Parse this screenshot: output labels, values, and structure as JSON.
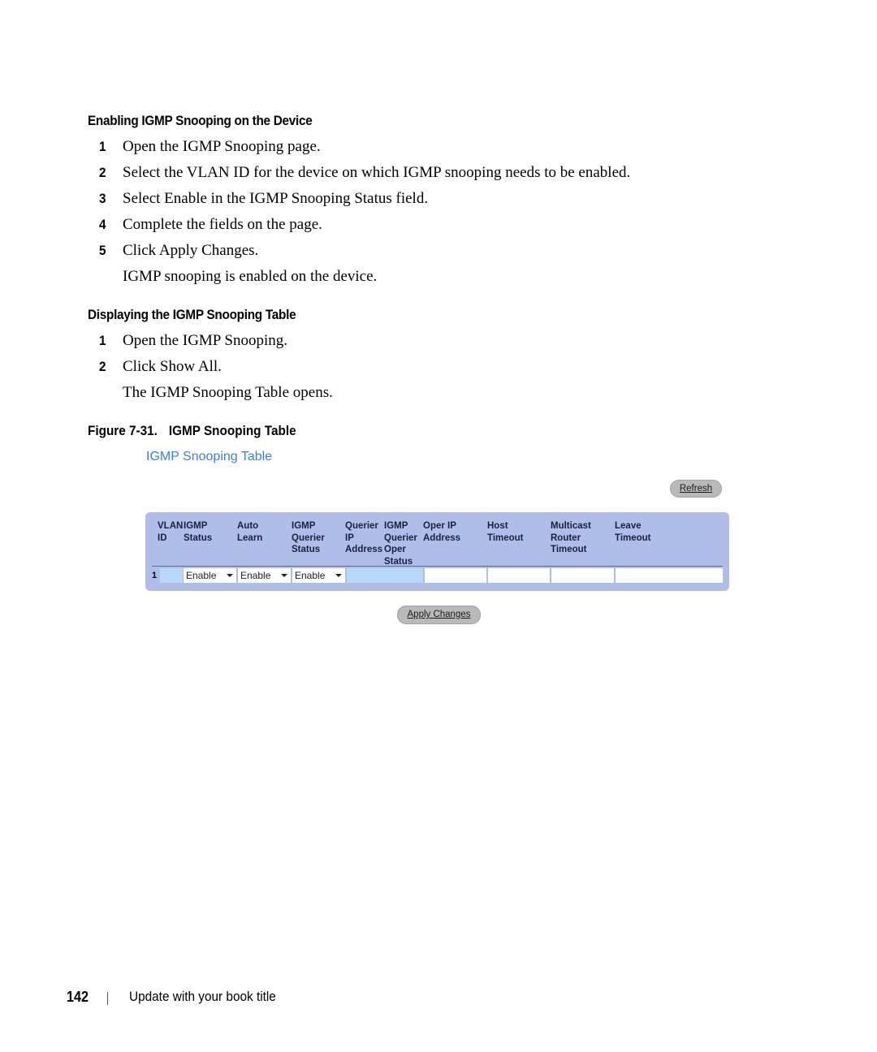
{
  "section1": {
    "heading": "Enabling IGMP Snooping on the Device",
    "steps": [
      {
        "num": "1",
        "text": "Open the IGMP Snooping page."
      },
      {
        "num": "2",
        "text": "Select the VLAN ID for the device on which IGMP snooping needs to be enabled."
      },
      {
        "num": "3",
        "text": "Select Enable in the IGMP Snooping Status field."
      },
      {
        "num": "4",
        "text": "Complete the fields on the page."
      },
      {
        "num": "5",
        "text": "Click Apply Changes."
      }
    ],
    "result": "IGMP snooping is enabled on the device."
  },
  "section2": {
    "heading": "Displaying the IGMP Snooping Table",
    "steps": [
      {
        "num": "1",
        "text": "Open the IGMP Snooping."
      },
      {
        "num": "2",
        "text": "Click Show All."
      }
    ],
    "result": "The IGMP Snooping Table opens."
  },
  "figure": {
    "number": "Figure 7-31.",
    "title": "IGMP Snooping Table"
  },
  "ui": {
    "title": "IGMP Snooping Table",
    "refresh_label": "Refresh",
    "apply_label": "Apply Changes",
    "columns": [
      "VLAN\nID",
      "IGMP\nStatus",
      "Auto\nLearn",
      "IGMP\nQuerier\nStatus",
      "Querier\nIP\nAddress",
      "IGMP\nQuerier\nOper\nStatus",
      "Oper IP\nAddress",
      "Host\nTimeout",
      "Multicast\nRouter\nTimeout",
      "Leave\nTimeout"
    ],
    "rows": [
      {
        "vlan_id": "1",
        "igmp_status": "Enable",
        "auto_learn": "Enable",
        "igmp_querier_status": "Enable",
        "querier_ip_address": "",
        "igmp_querier_oper_status": "",
        "oper_ip_address": "",
        "host_timeout": "",
        "multicast_router_timeout": "",
        "leave_timeout": ""
      }
    ],
    "colors": {
      "title": "#3d7ddb",
      "panel": "#aebee8",
      "cell_highlight": "#b7d8f7",
      "button": "#b9b9b9"
    }
  },
  "footer": {
    "page_number": "142",
    "separator": "|",
    "book_title": "Update with your book title"
  }
}
